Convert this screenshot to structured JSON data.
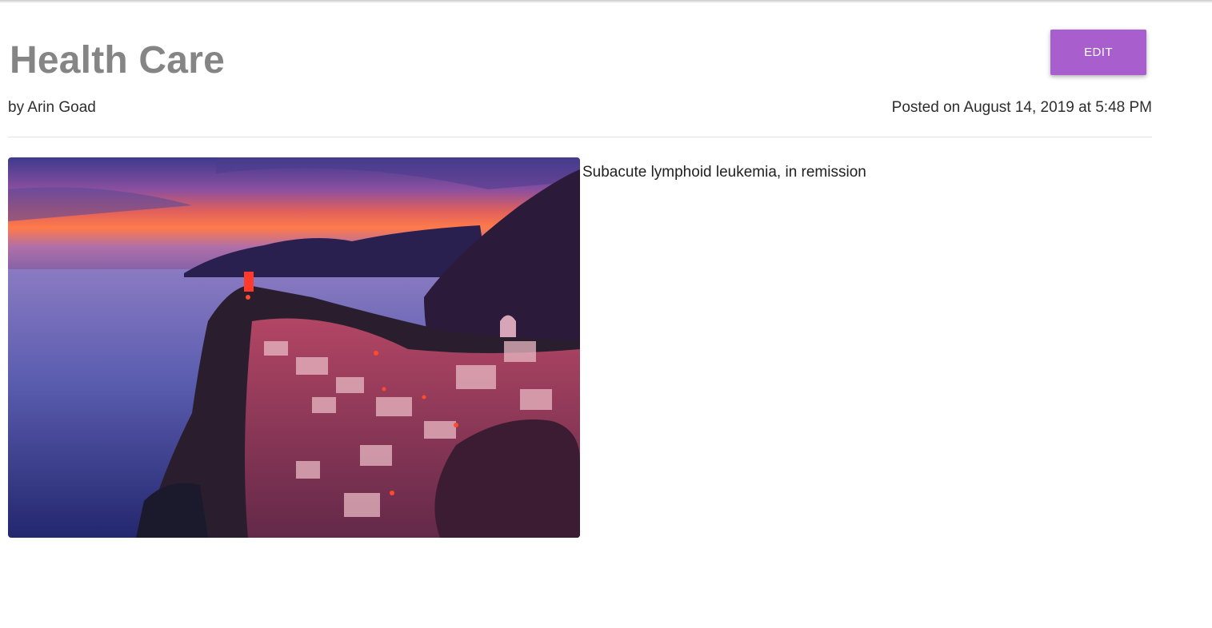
{
  "post": {
    "title": "Health Care",
    "author": "by Arin Goad",
    "posted": "Posted on August 14, 2019 at 5:48 PM",
    "body": "Subacute lymphoid leukemia, in remission",
    "image": "coastal-village-sunset-photo"
  },
  "actions": {
    "edit_label": "EDIT"
  },
  "colors": {
    "accent": "#a85fcd",
    "title": "#858585"
  }
}
